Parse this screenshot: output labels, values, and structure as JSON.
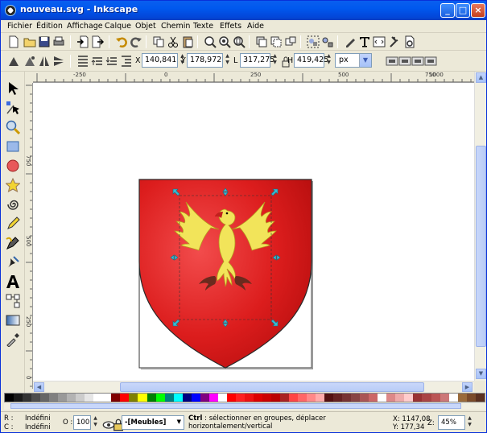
{
  "window": {
    "title": "nouveau.svg - Inkscape",
    "app_icon": "inkscape-icon",
    "controls": [
      "_",
      "□",
      "×"
    ]
  },
  "menu": [
    "Fichier",
    "Édition",
    "Affichage",
    "Calque",
    "Objet",
    "Chemin",
    "Texte",
    "Effets",
    "Aide"
  ],
  "command_bar": {
    "icons": [
      "new-document-icon",
      "open-icon",
      "save-icon",
      "print-icon",
      "import-icon",
      "export-icon",
      "undo-icon",
      "redo-icon",
      "copy-icon",
      "cut-icon",
      "paste-icon",
      "zoom-selection-icon",
      "zoom-drawing-icon",
      "zoom-page-icon",
      "duplicate-icon",
      "clone-icon",
      "unlink-clone-icon",
      "group-icon",
      "ungroup-icon",
      "fill-stroke-icon",
      "text-font-icon",
      "xml-editor-icon",
      "preferences-icon",
      "document-properties-icon"
    ]
  },
  "controls_bar": {
    "x_label": "X",
    "x_value": "140,841",
    "y_label": "Y",
    "y_value": "178,972",
    "w_label": "L",
    "w_value": "317,275",
    "h_label": "H",
    "h_value": "419,425",
    "unit": "px"
  },
  "ruler": {
    "labels": [
      "-250",
      "0",
      "250",
      "500",
      "750",
      "1000"
    ]
  },
  "vertical_ruler": {
    "labels": [
      "750",
      "500",
      "250",
      "0"
    ]
  },
  "tools": [
    "selector-icon",
    "node-editor-icon",
    "zoom-tool-icon",
    "rectangle-tool-icon",
    "ellipse-tool-icon",
    "star-tool-icon",
    "spiral-tool-icon",
    "pencil-tool-icon",
    "pen-tool-icon",
    "calligraphy-tool-icon",
    "text-tool-icon",
    "connector-tool-icon",
    "gradient-tool-icon",
    "dropper-tool-icon"
  ],
  "palette": [
    "#000000",
    "#1a1a1a",
    "#333333",
    "#4d4d4d",
    "#666666",
    "#808080",
    "#999999",
    "#b3b3b3",
    "#cccccc",
    "#e6e6e6",
    "#ffffff",
    "#ffffff",
    "#800000",
    "#ff0000",
    "#808000",
    "#ffff00",
    "#008000",
    "#00ff00",
    "#008080",
    "#00ffff",
    "#000080",
    "#0000ff",
    "#800080",
    "#ff00ff",
    "#ffffff",
    "#ff0000",
    "#ff2020",
    "#ee1111",
    "#dd0000",
    "#cc0000",
    "#bb0000",
    "#aa2222",
    "#ff4444",
    "#ff6666",
    "#ff8888",
    "#ffaaaa",
    "#551111",
    "#662222",
    "#773333",
    "#884444",
    "#aa5555",
    "#cc6666",
    "#ffffff",
    "#dd8888",
    "#eeaaaa",
    "#ffcccc",
    "#993333",
    "#aa4444",
    "#bb5555",
    "#cc7777",
    "#ffffff",
    "#9a6a3a",
    "#7a4a2a",
    "#5a3020"
  ],
  "status": {
    "fill_label": "R :",
    "fill_value": "Indéfini",
    "stroke_label": "C :",
    "stroke_value": "Indéfini",
    "opacity_label": "O :",
    "opacity_value": "100",
    "layer": "-[Meubles]",
    "message_key": "Ctrl",
    "message": " : sélectionner en groupes, déplacer horizontalement/vertical",
    "coord_x": "X: 1147,08",
    "coord_y": "Y: 177,34",
    "zoom_label": "Z:",
    "zoom_value": "45%"
  },
  "colors": {
    "shield_red": "#DC1D1D",
    "eagle_gold": "#F2E45A",
    "selection_handle": "#38B8D0"
  }
}
